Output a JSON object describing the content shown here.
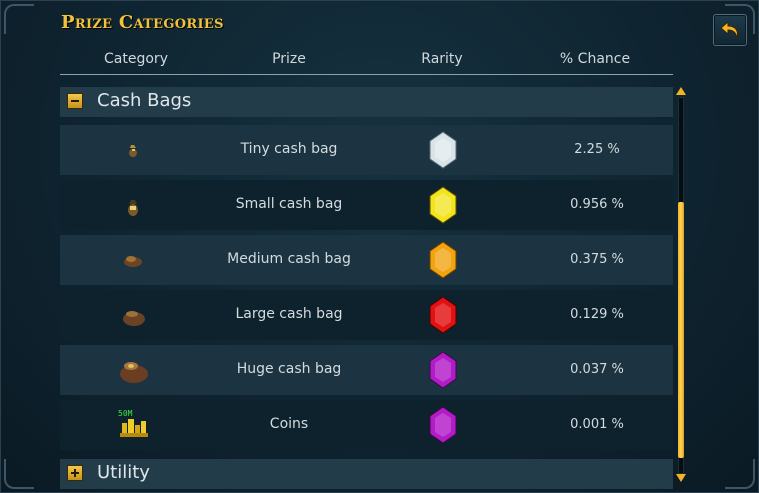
{
  "window": {
    "title": "Prize Categories",
    "back_icon": "back-arrow-icon"
  },
  "headers": {
    "category": "Category",
    "prize": "Prize",
    "rarity": "Rarity",
    "chance": "% Chance"
  },
  "sections": [
    {
      "label": "Cash Bags",
      "expanded": true
    },
    {
      "label": "Utility",
      "expanded": false
    }
  ],
  "items": [
    {
      "prize": "Tiny cash bag",
      "chance": "2.25 %",
      "icon": "tiny-cash-bag-icon",
      "rarity": "common",
      "gem_color": "#d8e4ea"
    },
    {
      "prize": "Small cash bag",
      "chance": "0.956 %",
      "icon": "small-cash-bag-icon",
      "rarity": "uncommon",
      "gem_color": "#f2e31b"
    },
    {
      "prize": "Medium cash bag",
      "chance": "0.375 %",
      "icon": "medium-cash-bag-icon",
      "rarity": "rare",
      "gem_color": "#f2a310"
    },
    {
      "prize": "Large cash bag",
      "chance": "0.129 %",
      "icon": "large-cash-bag-icon",
      "rarity": "very-rare",
      "gem_color": "#e31212"
    },
    {
      "prize": "Huge cash bag",
      "chance": "0.037 %",
      "icon": "huge-cash-bag-icon",
      "rarity": "extremely-rare",
      "gem_color": "#b21cc7"
    },
    {
      "prize": "Coins",
      "chance": "0.001 %",
      "icon": "coins-icon",
      "rarity": "extremely-rare",
      "gem_color": "#b21cc7",
      "stack_label": "50M"
    }
  ],
  "colors": {
    "title": "#f2c23a",
    "accent_gold": "#f3b424",
    "row_light": "#1c3441",
    "row_dark": "#0e222d"
  },
  "scrollbar": {
    "position_fraction": 0.3,
    "visible_fraction": 0.68
  }
}
